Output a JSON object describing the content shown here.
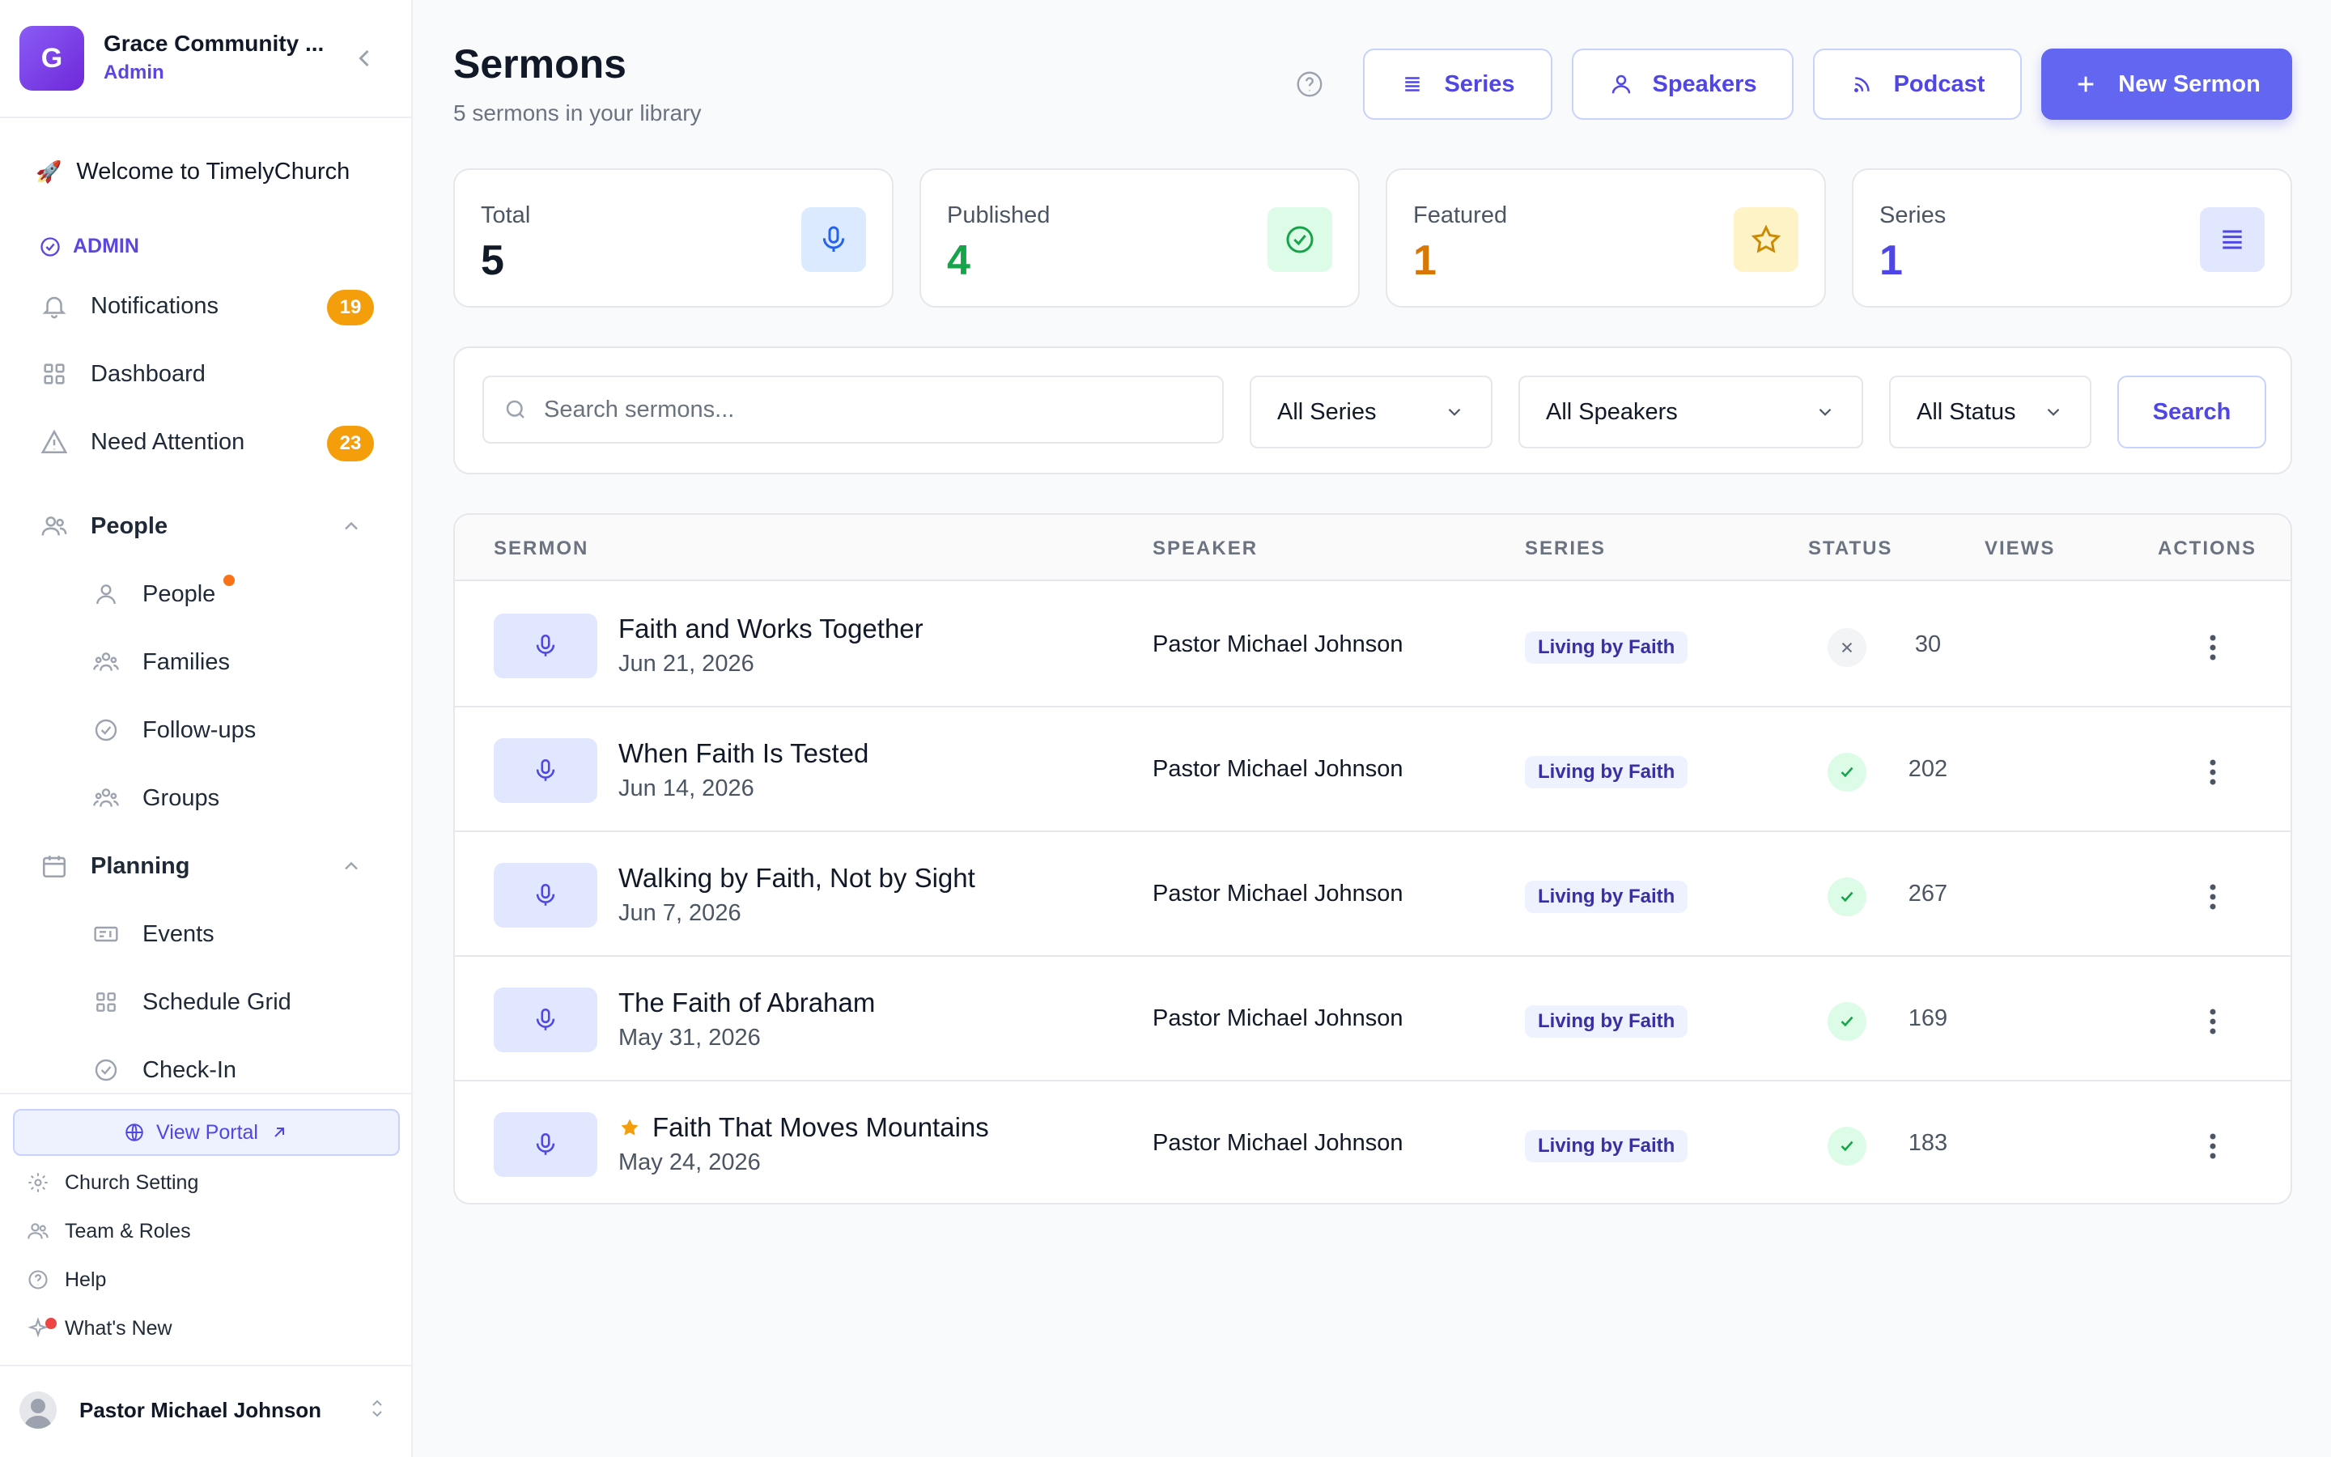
{
  "org": {
    "initial": "G",
    "name": "Grace Community ...",
    "role": "Admin"
  },
  "sidebar": {
    "welcome": "Welcome to TimelyChurch",
    "section_admin": "ADMIN",
    "notifications": {
      "label": "Notifications",
      "badge": "19"
    },
    "dashboard": "Dashboard",
    "need_attention": {
      "label": "Need Attention",
      "badge": "23"
    },
    "people_group": "People",
    "people_items": [
      "People",
      "Families",
      "Follow-ups",
      "Groups"
    ],
    "planning_group": "Planning",
    "planning_items": [
      "Events",
      "Schedule Grid",
      "Check-In"
    ],
    "view_portal": "View Portal",
    "footer": [
      "Church Setting",
      "Team & Roles",
      "Help",
      "What's New"
    ],
    "user": "Pastor Michael Johnson"
  },
  "header": {
    "title": "Sermons",
    "subtitle": "5 sermons in your library",
    "btn_series": "Series",
    "btn_speakers": "Speakers",
    "btn_podcast": "Podcast",
    "btn_new": "New Sermon"
  },
  "stats": [
    {
      "label": "Total",
      "value": "5",
      "color": "#111827",
      "icon": "mic-icon",
      "bg": "#dbeafe"
    },
    {
      "label": "Published",
      "value": "4",
      "color": "#16a34a",
      "icon": "check-circle-icon",
      "bg": "#dcfce7"
    },
    {
      "label": "Featured",
      "value": "1",
      "color": "#d97706",
      "icon": "star-icon",
      "bg": "#fef3c7"
    },
    {
      "label": "Series",
      "value": "1",
      "color": "#4f46e5",
      "icon": "list-icon",
      "bg": "#e0e7ff"
    }
  ],
  "filters": {
    "search_placeholder": "Search sermons...",
    "series": "All Series",
    "speakers": "All Speakers",
    "status": "All Status",
    "search_btn": "Search"
  },
  "table": {
    "columns": [
      "SERMON",
      "SPEAKER",
      "SERIES",
      "STATUS",
      "VIEWS",
      "ACTIONS"
    ],
    "rows": [
      {
        "title": "Faith and Works Together",
        "date": "Jun 21, 2026",
        "speaker": "Pastor Michael Johnson",
        "series": "Living by Faith",
        "status": "draft",
        "views": "30",
        "featured": false
      },
      {
        "title": "When Faith Is Tested",
        "date": "Jun 14, 2026",
        "speaker": "Pastor Michael Johnson",
        "series": "Living by Faith",
        "status": "published",
        "views": "202",
        "featured": false
      },
      {
        "title": "Walking by Faith, Not by Sight",
        "date": "Jun 7, 2026",
        "speaker": "Pastor Michael Johnson",
        "series": "Living by Faith",
        "status": "published",
        "views": "267",
        "featured": false
      },
      {
        "title": "The Faith of Abraham",
        "date": "May 31, 2026",
        "speaker": "Pastor Michael Johnson",
        "series": "Living by Faith",
        "status": "published",
        "views": "169",
        "featured": false
      },
      {
        "title": "Faith That Moves Mountains",
        "date": "May 24, 2026",
        "speaker": "Pastor Michael Johnson",
        "series": "Living by Faith",
        "status": "published",
        "views": "183",
        "featured": true
      }
    ]
  }
}
